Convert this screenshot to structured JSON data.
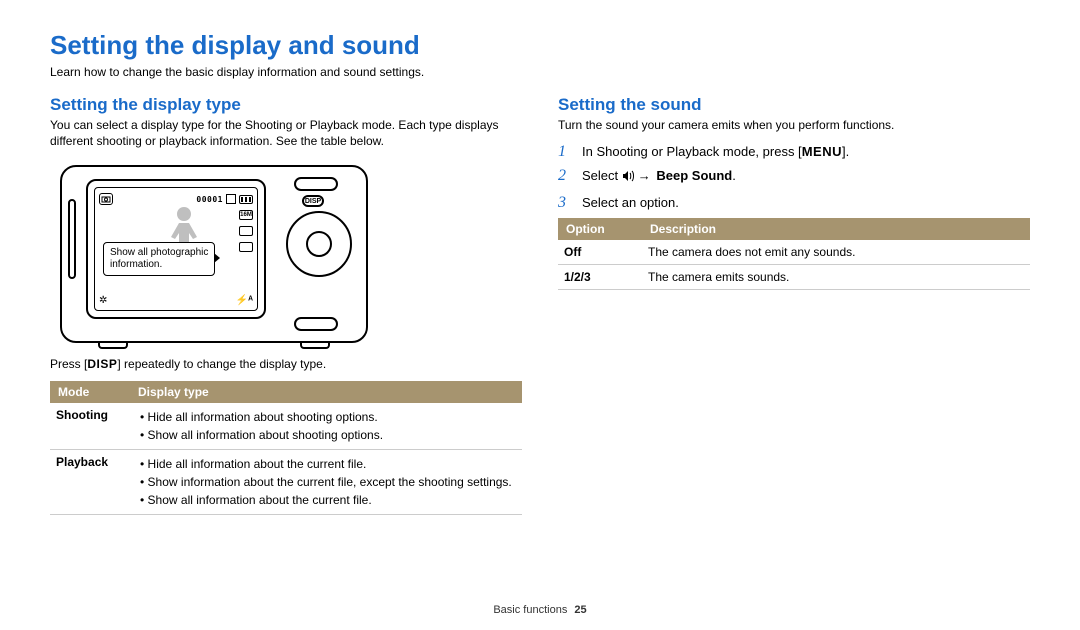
{
  "page": {
    "title": "Setting the display and sound",
    "intro": "Learn how to change the basic display information and sound settings.",
    "footer_section": "Basic functions",
    "footer_page": "25"
  },
  "left": {
    "heading": "Setting the display type",
    "desc": "You can select a display type for the Shooting or Playback mode. Each type displays different shooting or playback information. See the table below.",
    "lcd": {
      "counter": "00001",
      "callout_line1": "Show all photographic",
      "callout_line2": "information.",
      "disp_label": "DISP"
    },
    "press_before": "Press [",
    "press_key": "DISP",
    "press_after": "] repeatedly to change the display type.",
    "table": {
      "head_mode": "Mode",
      "head_type": "Display type",
      "rows": [
        {
          "mode": "Shooting",
          "items": [
            "Hide all information about shooting options.",
            "Show all information about shooting options."
          ]
        },
        {
          "mode": "Playback",
          "items": [
            "Hide all information about the current file.",
            "Show information about the current file, except the shooting settings.",
            "Show all information about the current file."
          ]
        }
      ]
    }
  },
  "right": {
    "heading": "Setting the sound",
    "desc": "Turn the sound your camera emits when you perform functions.",
    "steps": {
      "s1_num": "1",
      "s1_a": "In Shooting or Playback mode, press [",
      "s1_key": "MENU",
      "s1_b": "].",
      "s2_num": "2",
      "s2_a": "Select ",
      "s2_arrow": "→",
      "s2_bold": "Beep Sound",
      "s2_b": ".",
      "s3_num": "3",
      "s3_a": "Select an option."
    },
    "table": {
      "head_option": "Option",
      "head_desc": "Description",
      "rows": [
        {
          "opt": "Off",
          "desc": "The camera does not emit any sounds."
        },
        {
          "opt": "1/2/3",
          "desc": "The camera emits sounds."
        }
      ]
    }
  }
}
